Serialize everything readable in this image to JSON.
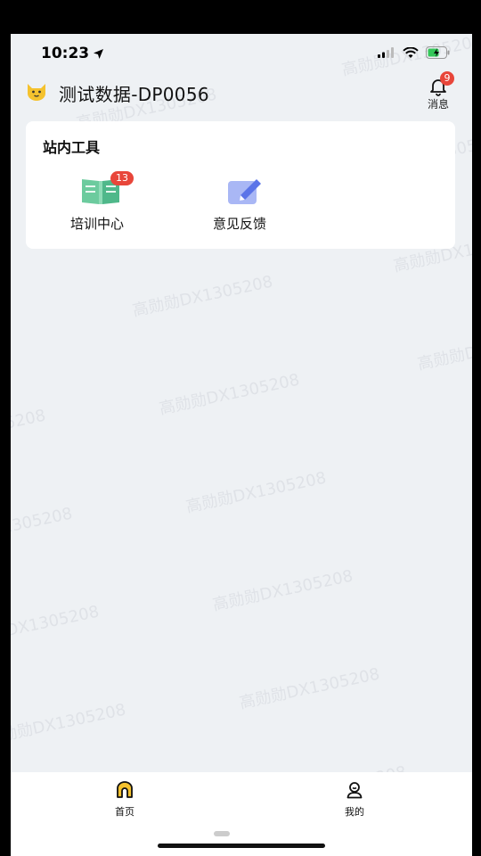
{
  "status_bar": {
    "time": "10:23"
  },
  "header": {
    "title": "测试数据-DP0056",
    "message_label": "消息",
    "message_badge": "9"
  },
  "tools_card": {
    "title": "站内工具",
    "items": [
      {
        "label": "培训中心",
        "badge": "13",
        "icon": "book-icon"
      },
      {
        "label": "意见反馈",
        "badge": "",
        "icon": "feedback-edit-icon"
      }
    ]
  },
  "watermark": {
    "text": "高勋勋DX1305208"
  },
  "tabbar": {
    "items": [
      {
        "label": "首页",
        "icon": "home-icon"
      },
      {
        "label": "我的",
        "icon": "profile-icon"
      }
    ]
  },
  "colors": {
    "badge": "#E8463A",
    "background": "#EEF1F4",
    "home_icon": "#F5C22E"
  }
}
